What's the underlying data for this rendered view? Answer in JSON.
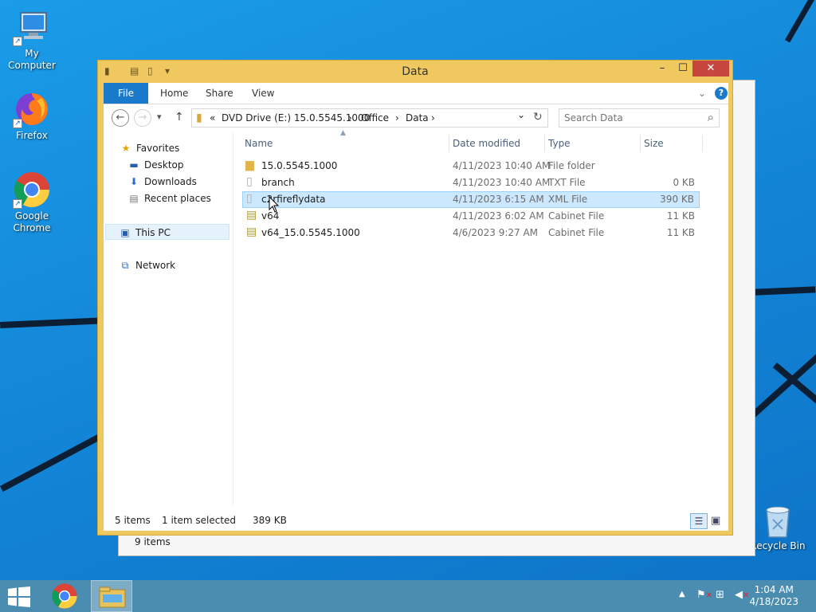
{
  "desktop": {
    "icons": [
      {
        "label": "My Computer",
        "icon": "my-computer-icon"
      },
      {
        "label": "Firefox",
        "icon": "firefox-icon"
      },
      {
        "label": "Google Chrome",
        "icon": "chrome-icon"
      },
      {
        "label": "Recycle Bin",
        "icon": "recycle-bin-icon"
      }
    ]
  },
  "back_window": {
    "status": "9 items"
  },
  "window": {
    "title": "Data",
    "controls": {
      "minimize": "–",
      "maximize": "☐",
      "close": "✕"
    },
    "ribbon": {
      "tabs": [
        "File",
        "Home",
        "Share",
        "View"
      ]
    },
    "nav": {
      "back": "←",
      "forward": "→",
      "recent": "▾",
      "up": "↑"
    },
    "address": {
      "prefix": "«",
      "segments": [
        "DVD Drive (E:) 15.0.5545.1000",
        "Office",
        "Data"
      ],
      "separator": "›",
      "dropdown": "⌄",
      "refresh": "↻"
    },
    "search": {
      "placeholder": "Search Data",
      "icon": "⌕"
    },
    "sidebar": {
      "favorites_label": "Favorites",
      "favorites": [
        "Desktop",
        "Downloads",
        "Recent places"
      ],
      "this_pc": "This PC",
      "network": "Network"
    },
    "columns": {
      "name": "Name",
      "date": "Date modified",
      "type": "Type",
      "size": "Size"
    },
    "files": [
      {
        "name": "15.0.5545.1000",
        "date": "4/11/2023 10:40 AM",
        "type": "File folder",
        "size": "",
        "icon": "folder-icon"
      },
      {
        "name": "branch",
        "date": "4/11/2023 10:40 AM",
        "type": "TXT File",
        "size": "0 KB",
        "icon": "text-file-icon"
      },
      {
        "name": "c2rfireflydata",
        "date": "4/11/2023 6:15 AM",
        "type": "XML File",
        "size": "390 KB",
        "icon": "xml-file-icon",
        "selected": true
      },
      {
        "name": "v64",
        "date": "4/11/2023 6:02 AM",
        "type": "Cabinet File",
        "size": "11 KB",
        "icon": "cabinet-file-icon"
      },
      {
        "name": "v64_15.0.5545.1000",
        "date": "4/6/2023 9:27 AM",
        "type": "Cabinet File",
        "size": "11 KB",
        "icon": "cabinet-file-icon"
      }
    ],
    "status": {
      "count": "5 items",
      "selection": "1 item selected",
      "size": "389 KB"
    }
  },
  "taskbar": {
    "start_icon": "windows-start-icon",
    "apps": [
      "chrome-icon",
      "file-explorer-icon"
    ],
    "clock": {
      "time": "1:04 AM",
      "date": "4/18/2023"
    }
  },
  "colors": {
    "desktop": "#1487d8",
    "window_frame": "#f0c860",
    "file_tab": "#1979ca",
    "close_button": "#c7463e",
    "selection": "#cce8ff",
    "taskbar": "#4a8db0"
  }
}
